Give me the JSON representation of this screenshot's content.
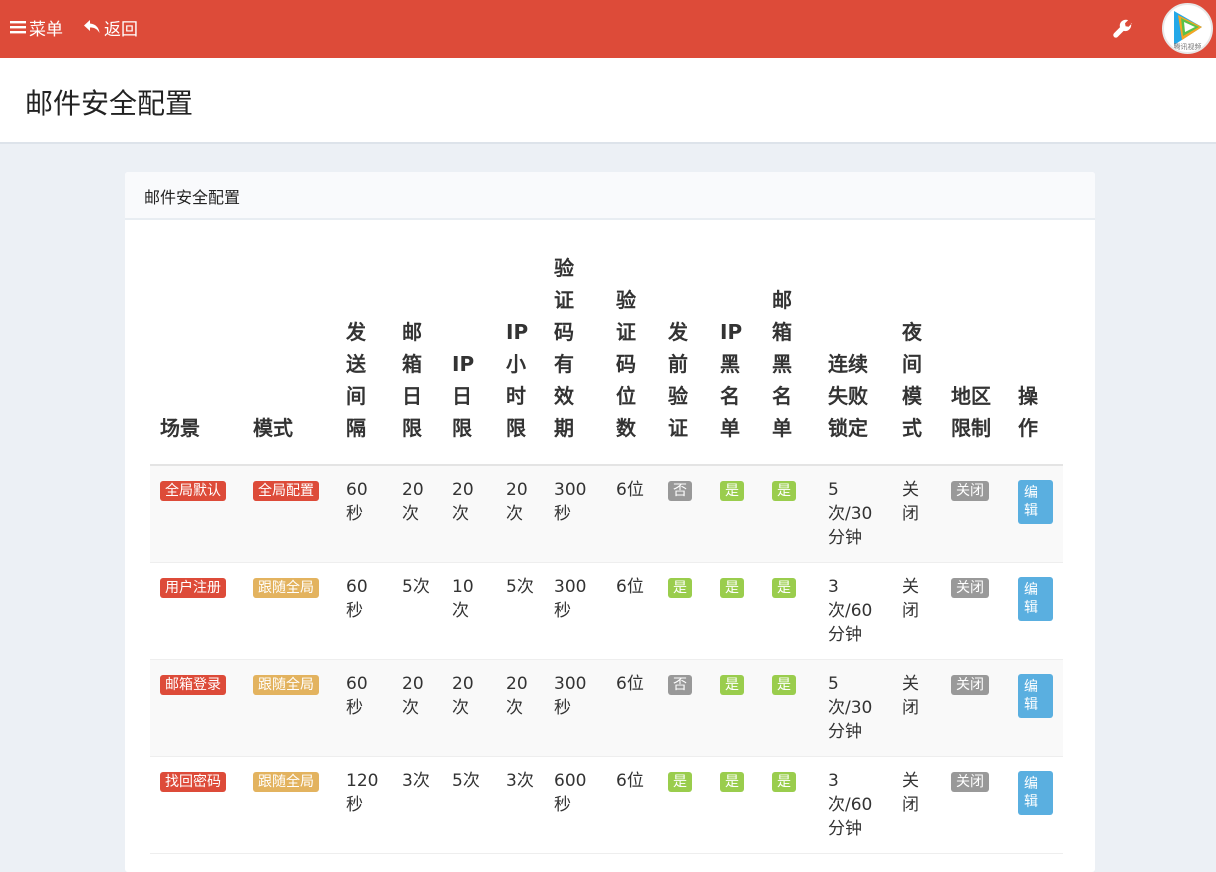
{
  "topbar": {
    "menu_label": "菜单",
    "back_label": "返回",
    "avatar_text": "腾讯视频"
  },
  "page": {
    "title": "邮件安全配置"
  },
  "box": {
    "title": "邮件安全配置"
  },
  "table": {
    "headers": [
      [
        "场景"
      ],
      [
        "模式"
      ],
      [
        "发",
        "送",
        "间",
        "隔"
      ],
      [
        "邮",
        "箱",
        "日",
        "限"
      ],
      [
        "IP",
        "日",
        "限"
      ],
      [
        "IP",
        "小",
        "时",
        "限"
      ],
      [
        "验",
        "证",
        "码",
        "有",
        "效",
        "期"
      ],
      [
        "验",
        "证",
        "码",
        "位",
        "数"
      ],
      [
        "发",
        "前",
        "验",
        "证"
      ],
      [
        "IP",
        "黑",
        "名",
        "单"
      ],
      [
        "邮",
        "箱",
        "黑",
        "名",
        "单"
      ],
      [
        "连续",
        "失败",
        "锁定"
      ],
      [
        "夜",
        "间",
        "模",
        "式"
      ],
      [
        "地区",
        "限制"
      ],
      [
        "操",
        "作"
      ]
    ],
    "rows": [
      {
        "scene": "全局默认",
        "mode": "全局配置",
        "send_interval": [
          "60",
          "秒"
        ],
        "email_daily": [
          "20",
          "次"
        ],
        "ip_daily": [
          "20",
          "次"
        ],
        "ip_hourly": [
          "20",
          "次"
        ],
        "code_valid": [
          "300",
          "秒"
        ],
        "code_digits": "6位",
        "pre_verify": "否",
        "ip_blacklist": "是",
        "email_blacklist": "是",
        "lock": [
          "5",
          "次/30",
          "分钟"
        ],
        "night_mode": [
          "关",
          "闭"
        ],
        "region_limit": "关闭",
        "action": "编辑"
      },
      {
        "scene": "用户注册",
        "mode": "跟随全局",
        "send_interval": [
          "60",
          "秒"
        ],
        "email_daily": [
          "5次"
        ],
        "ip_daily": [
          "10",
          "次"
        ],
        "ip_hourly": [
          "5次"
        ],
        "code_valid": [
          "300",
          "秒"
        ],
        "code_digits": "6位",
        "pre_verify": "是",
        "ip_blacklist": "是",
        "email_blacklist": "是",
        "lock": [
          "3",
          "次/60",
          "分钟"
        ],
        "night_mode": [
          "关",
          "闭"
        ],
        "region_limit": "关闭",
        "action": "编辑"
      },
      {
        "scene": "邮箱登录",
        "mode": "跟随全局",
        "send_interval": [
          "60",
          "秒"
        ],
        "email_daily": [
          "20",
          "次"
        ],
        "ip_daily": [
          "20",
          "次"
        ],
        "ip_hourly": [
          "20",
          "次"
        ],
        "code_valid": [
          "300",
          "秒"
        ],
        "code_digits": "6位",
        "pre_verify": "否",
        "ip_blacklist": "是",
        "email_blacklist": "是",
        "lock": [
          "5",
          "次/30",
          "分钟"
        ],
        "night_mode": [
          "关",
          "闭"
        ],
        "region_limit": "关闭",
        "action": "编辑"
      },
      {
        "scene": "找回密码",
        "mode": "跟随全局",
        "send_interval": [
          "120",
          "秒"
        ],
        "email_daily": [
          "3次"
        ],
        "ip_daily": [
          "5次"
        ],
        "ip_hourly": [
          "3次"
        ],
        "code_valid": [
          "600",
          "秒"
        ],
        "code_digits": "6位",
        "pre_verify": "是",
        "ip_blacklist": "是",
        "email_blacklist": "是",
        "lock": [
          "3",
          "次/60",
          "分钟"
        ],
        "night_mode": [
          "关",
          "闭"
        ],
        "region_limit": "关闭",
        "action": "编辑"
      }
    ]
  },
  "colors": {
    "topbar": "#dd4b39",
    "label_red": "#dd4b39",
    "label_orange": "#e3b35f",
    "label_gray": "#999999",
    "label_green": "#9acd4d",
    "button_blue": "#5aafe0"
  },
  "icons": [
    "hamburger-menu-icon",
    "back-arrow-icon",
    "wrench-icon",
    "video-logo-avatar"
  ]
}
